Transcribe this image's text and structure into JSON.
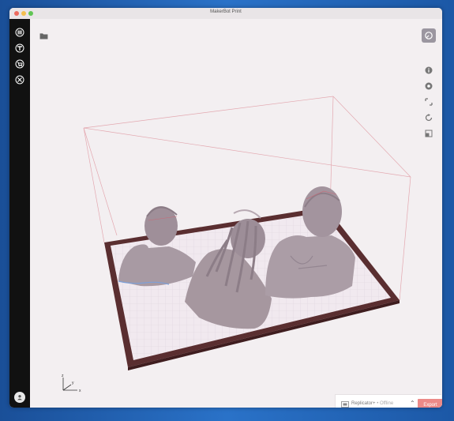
{
  "window": {
    "title": "MakerBot Print"
  },
  "sidebar": {
    "items": [
      {
        "icon": "library-icon"
      },
      {
        "icon": "thingiverse-icon"
      },
      {
        "icon": "cart-icon"
      },
      {
        "icon": "tools-icon"
      }
    ],
    "account_icon": "account-icon"
  },
  "viewport": {
    "left_toolbar": [
      {
        "icon": "folder-icon"
      }
    ],
    "right_top": {
      "icon": "printer-settings-icon"
    },
    "right_tools": [
      {
        "icon": "info-icon"
      },
      {
        "icon": "view-icon"
      },
      {
        "icon": "move-icon"
      },
      {
        "icon": "rotate-icon"
      },
      {
        "icon": "scale-icon"
      }
    ],
    "axes": {
      "x": "x",
      "y": "y",
      "z": "z"
    }
  },
  "printer_bar": {
    "printer_name": "Replicator+",
    "status": "• Offline",
    "export_label": "Export"
  },
  "colors": {
    "window_bg": "#f4f0f2",
    "sidebar": "#111111",
    "build_plate_border": "#5a2e30",
    "build_plate_grid": "#e9e1e8",
    "build_volume_lines": "#e3a8b0",
    "models": "#a89aa3",
    "export": "#ec8a88"
  }
}
